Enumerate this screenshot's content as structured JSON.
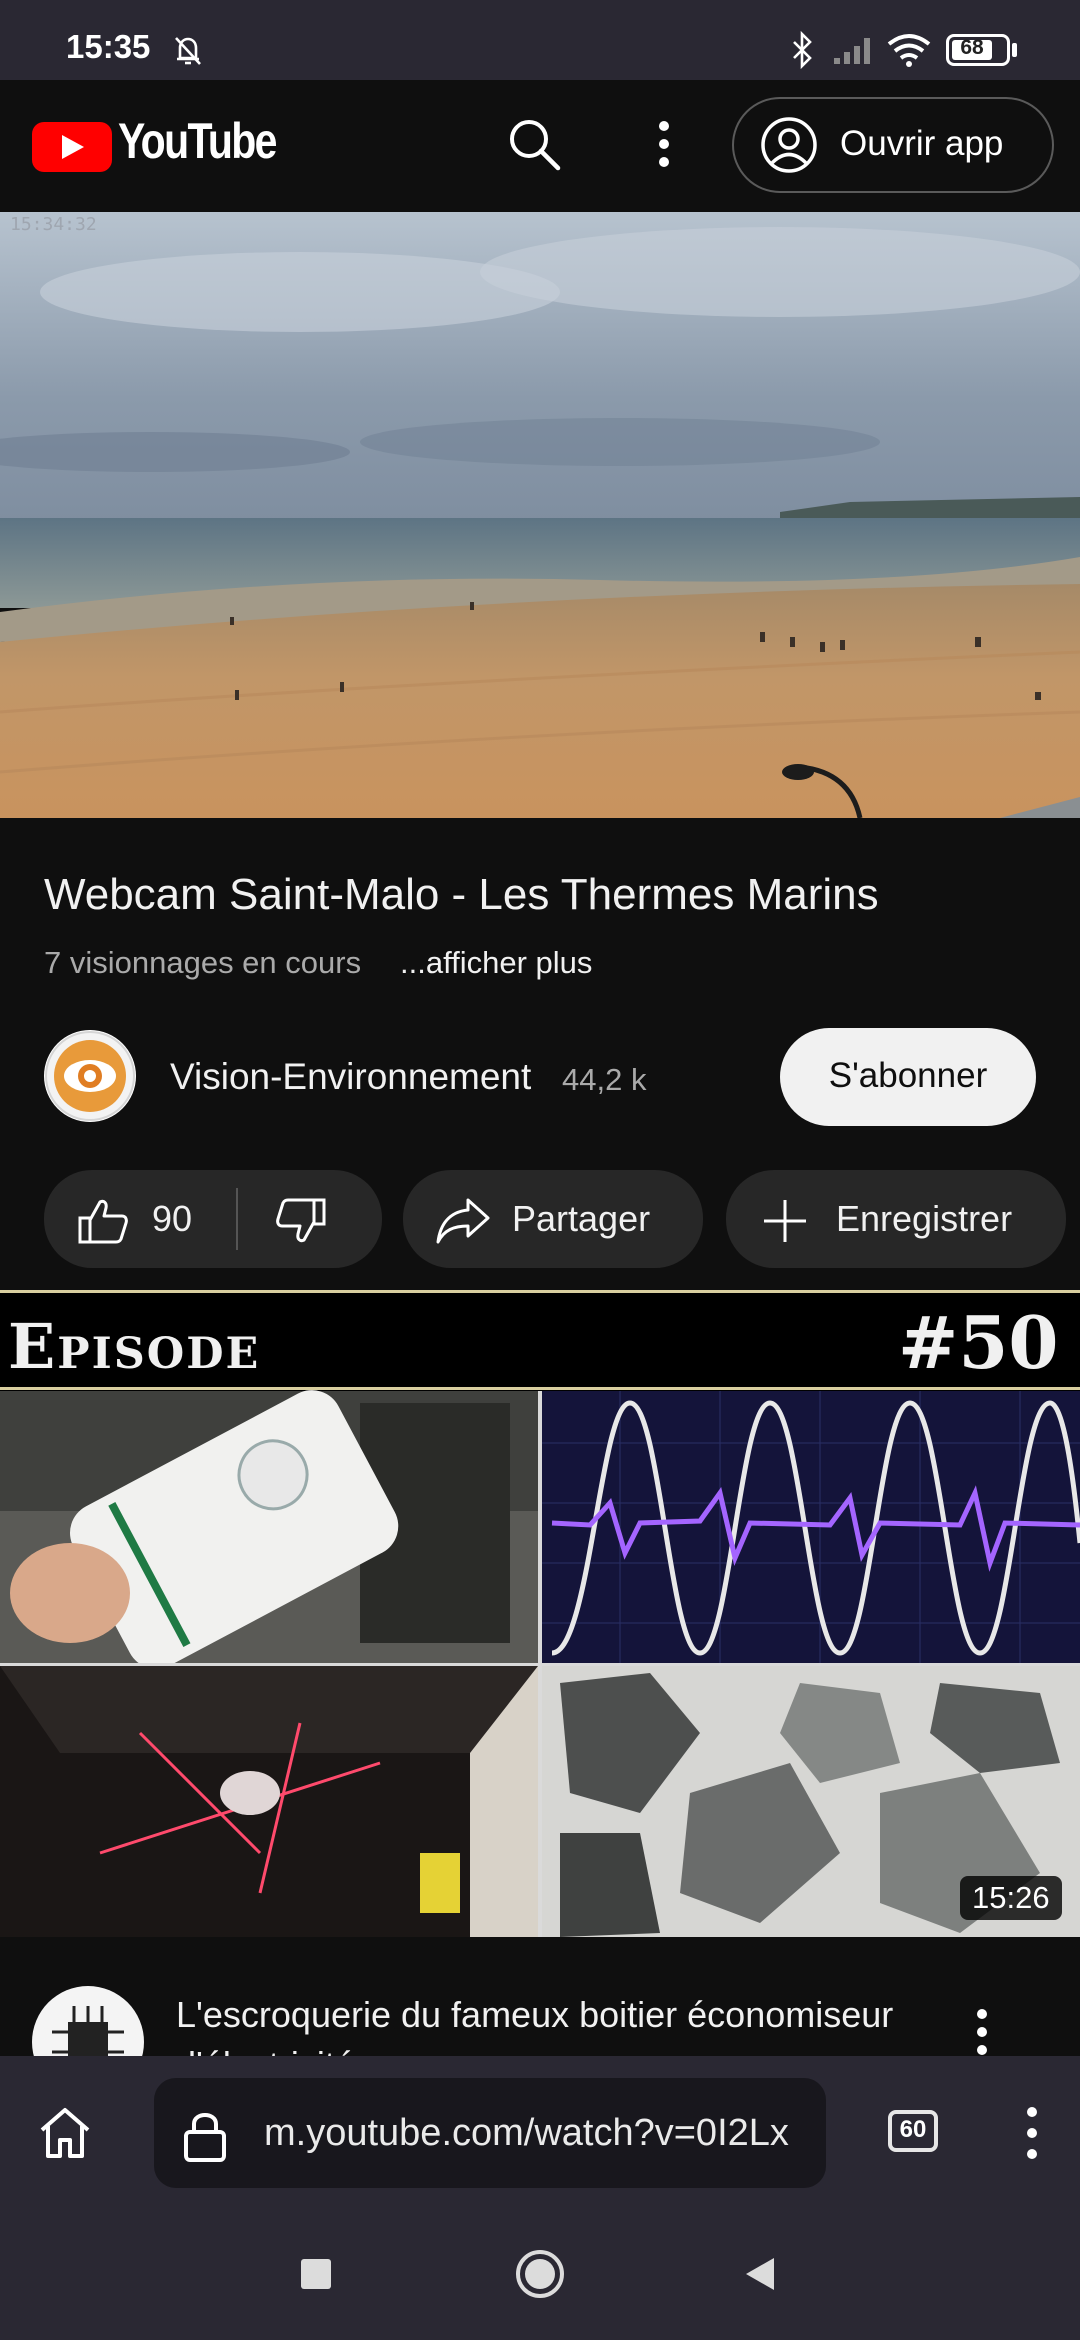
{
  "status_bar": {
    "time": "15:35",
    "battery": "68",
    "icons": [
      "mute-bell-icon",
      "bluetooth-icon",
      "signal-icon",
      "wifi-icon",
      "battery-icon"
    ]
  },
  "header": {
    "logo_text": "YouTube",
    "open_app_label": "Ouvrir app",
    "icons": [
      "search-icon",
      "more-vert-icon",
      "account-icon"
    ]
  },
  "player": {
    "timestamp": "15:34:32"
  },
  "video": {
    "title": "Webcam Saint-Malo - Les Thermes Marins",
    "views": "7 visionnages en cours",
    "show_more": "...afficher plus",
    "channel_name": "Vision-Environnement",
    "subscribers": "44,2 k",
    "subscribe_label": "S'abonner",
    "likes": "90",
    "share_label": "Partager",
    "save_label": "Enregistrer"
  },
  "next_video": {
    "episode_label": "Episode",
    "episode_number": "#50",
    "duration": "15:26",
    "title": "L'escroquerie du fameux boitier économiseur d'électricité"
  },
  "browser": {
    "url": "m.youtube.com/watch?v=0I2Lx",
    "tab_count": "60"
  },
  "colors": {
    "brand_red": "#ff0000",
    "background": "#0f0f0f",
    "chip": "#272727",
    "browser_bar": "#2a2833"
  }
}
